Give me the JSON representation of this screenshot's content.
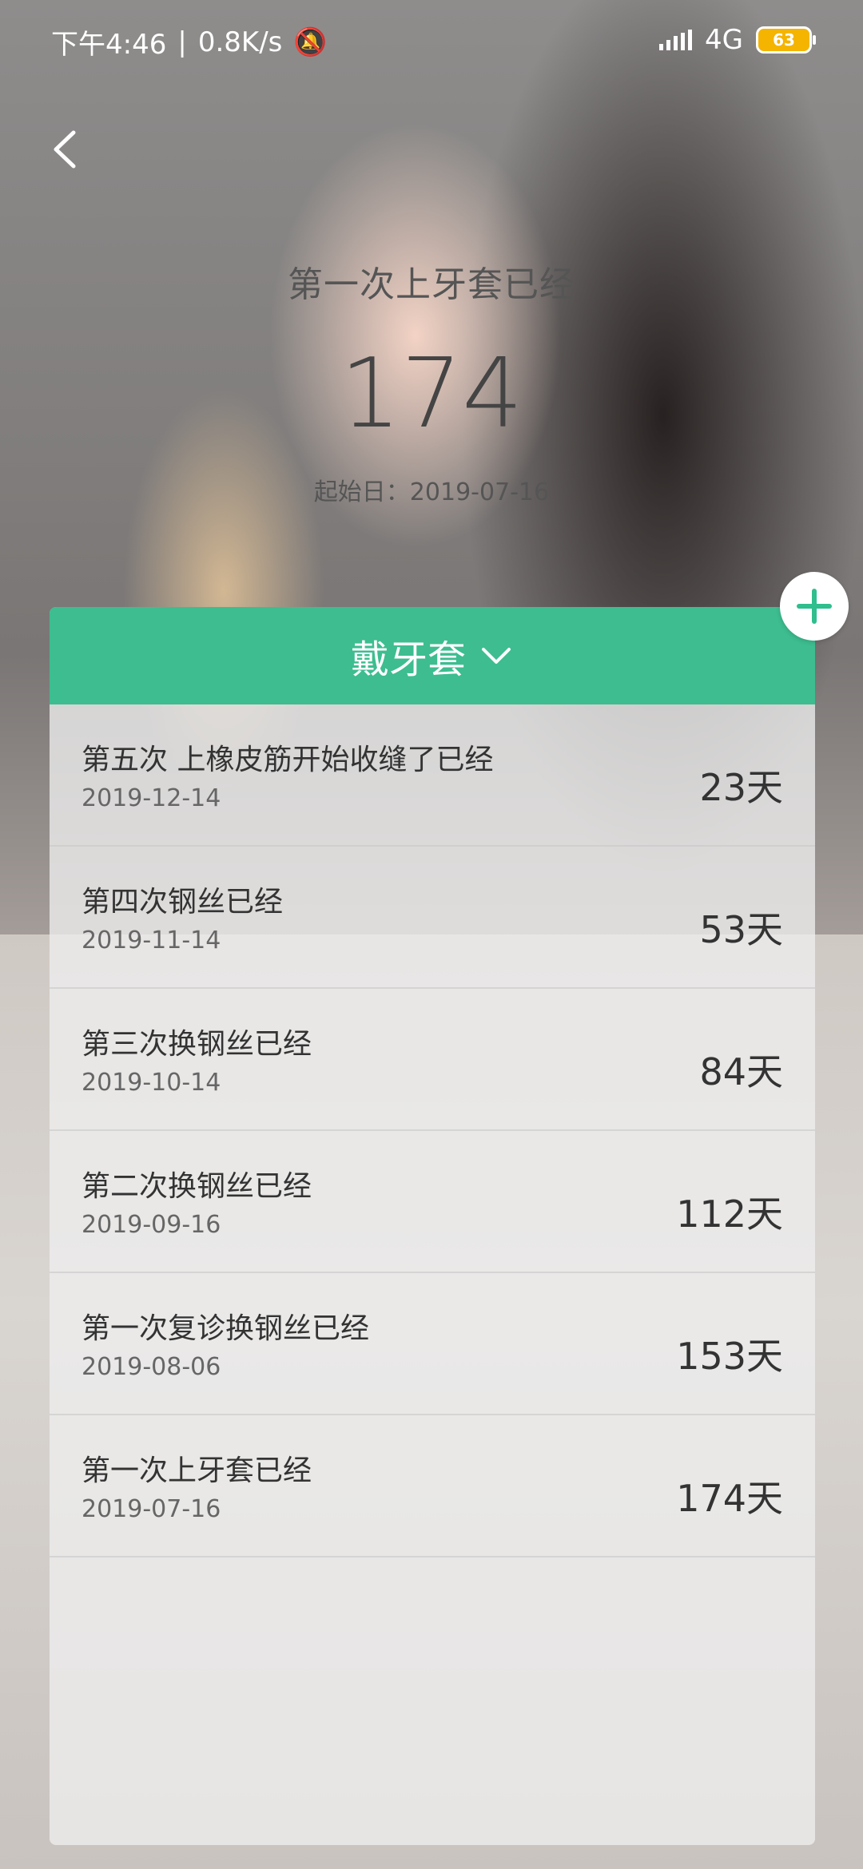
{
  "status_bar": {
    "time": "下午4:46",
    "speed": "0.8K/s",
    "network": "4G",
    "battery": "63"
  },
  "header": {
    "title": "第一次上牙套已经",
    "count": "174",
    "start_date": "起始日：2019-07-16"
  },
  "card": {
    "title": "戴牙套",
    "items": [
      {
        "title": "第五次  上橡皮筋开始收缝了已经",
        "date": "2019-12-14",
        "days": "23天"
      },
      {
        "title": "第四次钢丝已经",
        "date": "2019-11-14",
        "days": "53天"
      },
      {
        "title": "第三次换钢丝已经",
        "date": "2019-10-14",
        "days": "84天"
      },
      {
        "title": "第二次换钢丝已经",
        "date": "2019-09-16",
        "days": "112天"
      },
      {
        "title": "第一次复诊换钢丝已经",
        "date": "2019-08-06",
        "days": "153天"
      },
      {
        "title": "第一次上牙套已经",
        "date": "2019-07-16",
        "days": "174天"
      }
    ]
  },
  "colors": {
    "accent": "#3dbd90",
    "add_icon": "#2fbe8e"
  }
}
